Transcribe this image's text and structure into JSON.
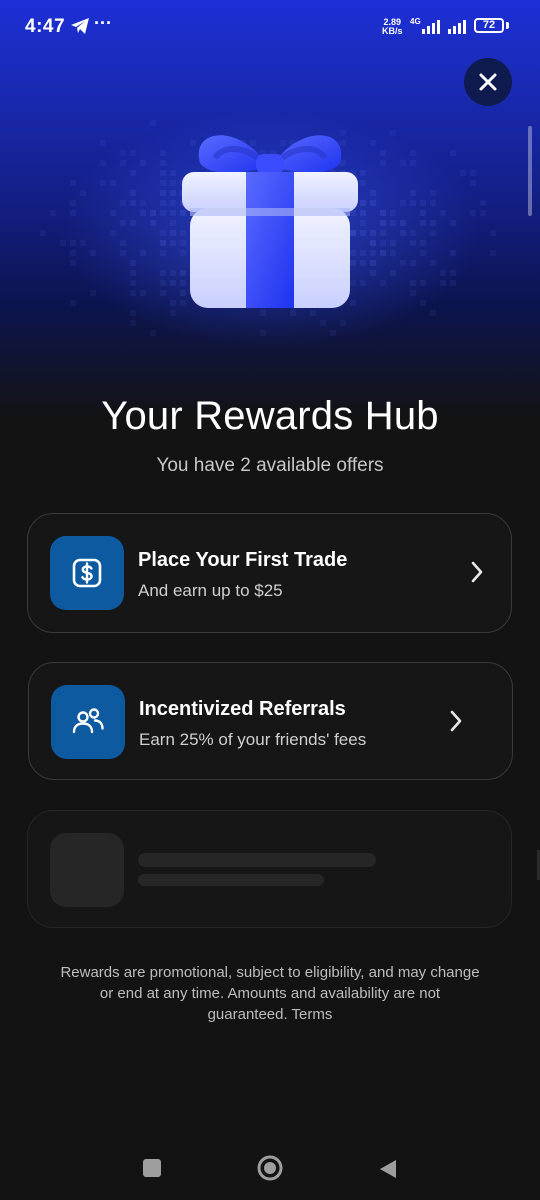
{
  "status_bar": {
    "time": "4:47",
    "overflow": "···",
    "speed_value": "2.89",
    "speed_unit": "KB/s",
    "network": "4G",
    "battery": "72"
  },
  "header": {
    "close_icon": "close-icon",
    "hero_icon": "gift-icon"
  },
  "main": {
    "title": "Your Rewards Hub",
    "subtitle": "You have 2 available offers"
  },
  "offers": [
    {
      "title": "Place Your First Trade",
      "description": "And earn up to $25",
      "icon": "dollar-icon"
    },
    {
      "title": "Incentivized Referrals",
      "description": "Earn 25% of your friends' fees",
      "icon": "users-icon"
    }
  ],
  "disclaimer": "Rewards are promotional, subject to eligibility, and may change or end at any time. Amounts and availability are not guaranteed. Terms",
  "colors": {
    "accent": "#0d5aa0",
    "hero_blue": "#1d2fd6",
    "background": "#131313"
  }
}
